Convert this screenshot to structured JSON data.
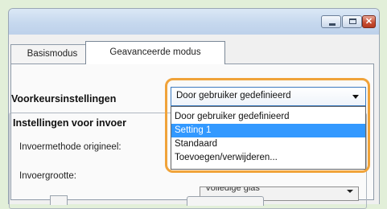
{
  "window": {
    "close_glyph": "✕"
  },
  "tabs": [
    {
      "label": "Basismodus",
      "active": false
    },
    {
      "label": "Geavanceerde modus",
      "active": true
    }
  ],
  "preferences": {
    "label": "Voorkeursinstellingen",
    "selected_value": "Door gebruiker gedefinieerd",
    "options": [
      {
        "label": "Door gebruiker gedefinieerd",
        "highlighted": false
      },
      {
        "label": "Setting 1",
        "highlighted": true
      },
      {
        "label": "Standaard",
        "highlighted": false
      },
      {
        "label": "Toevoegen/verwijderen...",
        "highlighted": false
      }
    ]
  },
  "input_settings": {
    "title": "Instellingen voor invoer",
    "fields": [
      {
        "label": "Invoermethode origineel:"
      },
      {
        "label": "Invoergrootte:",
        "value": "Volledige glas"
      }
    ]
  },
  "colors": {
    "page_background": "#e2efd9",
    "highlight_border": "#f0a33a",
    "selection": "#3399ff"
  }
}
